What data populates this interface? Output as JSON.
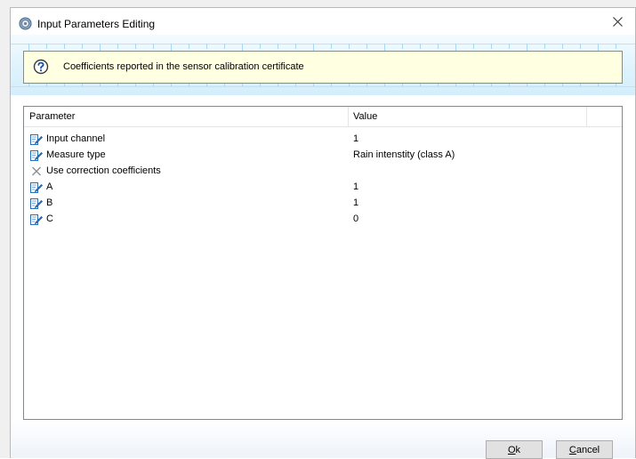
{
  "window": {
    "title": "Input Parameters Editing",
    "close_glyph": "✕"
  },
  "hint": {
    "text": "Coefficients reported in the sensor calibration certificate",
    "icon": "question-help-icon"
  },
  "grid": {
    "columns": [
      "Parameter",
      "Value"
    ],
    "rows": [
      {
        "name": "Input channel",
        "value": "1",
        "icon": "edit-pencil-icon"
      },
      {
        "name": "Measure type",
        "value": "Rain intenstity (class A)",
        "icon": "edit-pencil-icon"
      },
      {
        "name": "Use correction coefficients",
        "value": "",
        "icon": "x-mark-icon"
      },
      {
        "name": "A",
        "value": "1",
        "icon": "edit-pencil-icon"
      },
      {
        "name": "B",
        "value": "1",
        "icon": "edit-pencil-icon"
      },
      {
        "name": "C",
        "value": "0",
        "icon": "edit-pencil-icon"
      }
    ]
  },
  "buttons": {
    "ok": {
      "mnemonic": "O",
      "rest": "k"
    },
    "cancel": {
      "mnemonic": "C",
      "rest": "ancel"
    }
  },
  "colors": {
    "hint_background": "#ffffe1",
    "band_accent": "#d4eefb",
    "icon_blue": "#2b6fb6"
  }
}
